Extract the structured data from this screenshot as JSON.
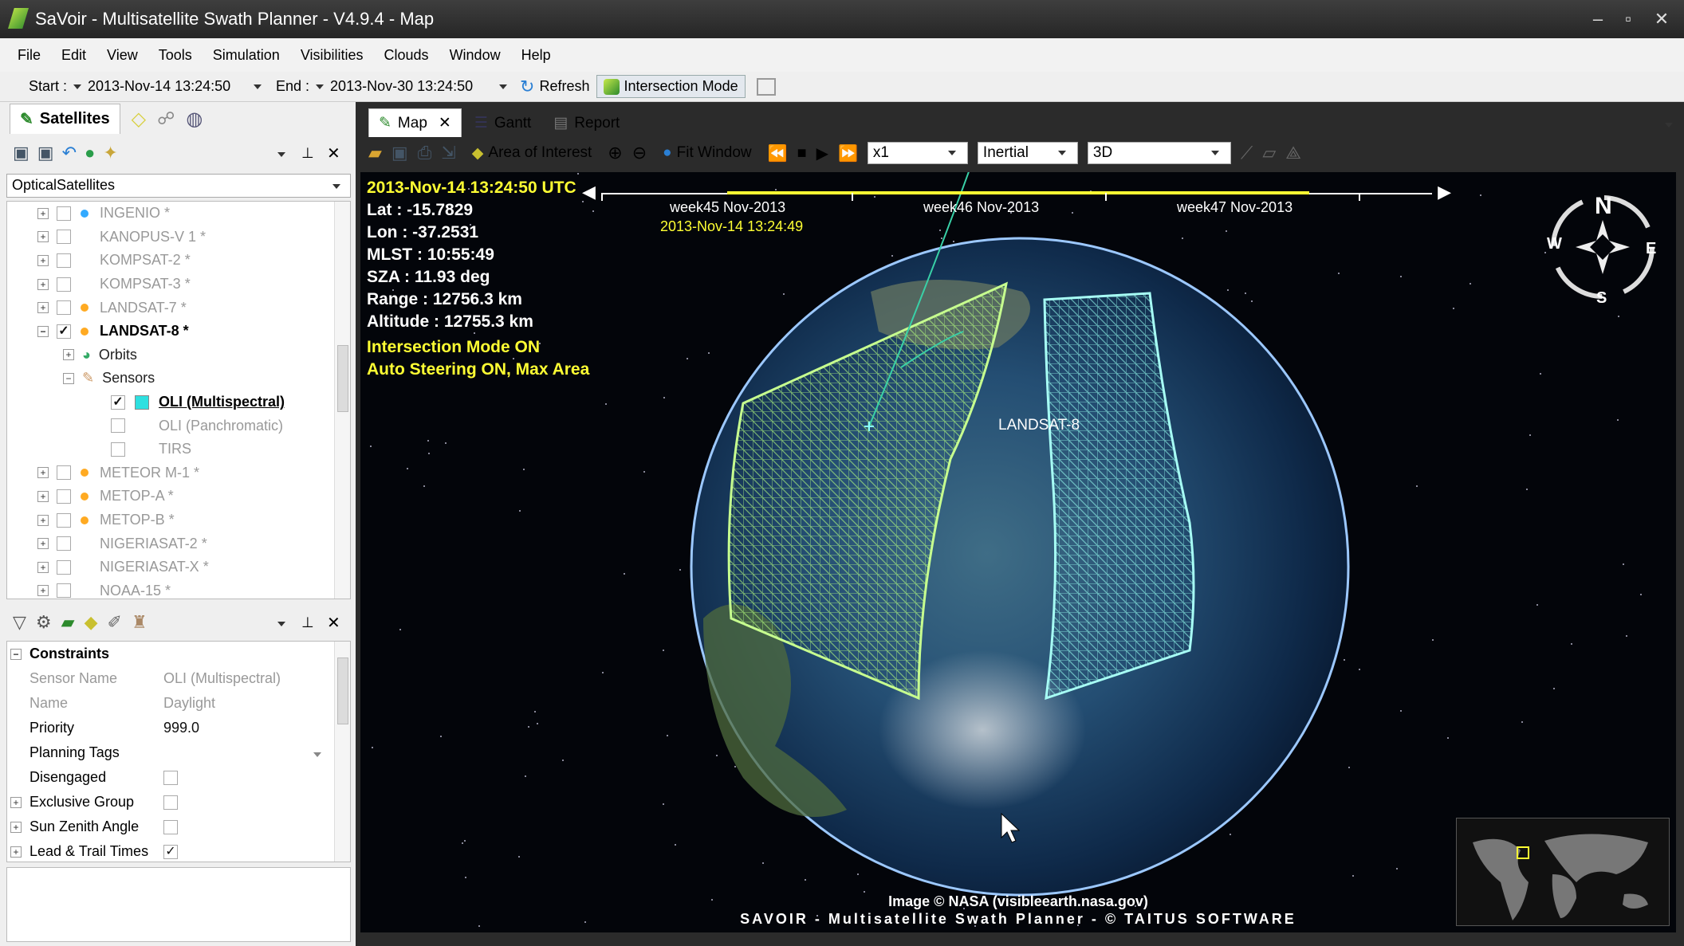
{
  "window": {
    "title": "SaVoir - Multisatellite Swath Planner - V4.9.4 - Map"
  },
  "menu": [
    "File",
    "Edit",
    "View",
    "Tools",
    "Simulation",
    "Visibilities",
    "Clouds",
    "Window",
    "Help"
  ],
  "toolbar": {
    "start_label": "Start :",
    "start_value": "2013-Nov-14 13:24:50",
    "end_label": "End :",
    "end_value": "2013-Nov-30 13:24:50",
    "refresh_label": "Refresh",
    "intersection_label": "Intersection Mode"
  },
  "left": {
    "satellites_tab": "Satellites",
    "group": "OpticalSatellites",
    "tree": [
      {
        "label": "INGENIO *",
        "dot": "#33aaff"
      },
      {
        "label": "KANOPUS-V 1 *"
      },
      {
        "label": "KOMPSAT-2 *"
      },
      {
        "label": "KOMPSAT-3 *"
      },
      {
        "label": "LANDSAT-7 *",
        "dot": "#ffaa22"
      },
      {
        "label": "LANDSAT-8 *",
        "dot": "#ffaa22"
      },
      {
        "label": "Orbits"
      },
      {
        "label": "Sensors"
      },
      {
        "label": "OLI (Multispectral)"
      },
      {
        "label": "OLI (Panchromatic)"
      },
      {
        "label": "TIRS"
      },
      {
        "label": "METEOR M-1 *",
        "dot": "#ffaa22"
      },
      {
        "label": "METOP-A *",
        "dot": "#ffaa22"
      },
      {
        "label": "METOP-B *",
        "dot": "#ffaa22"
      },
      {
        "label": "NIGERIASAT-2 *"
      },
      {
        "label": "NIGERIASAT-X *"
      },
      {
        "label": "NOAA-15 *"
      }
    ],
    "props": {
      "section": "Constraints",
      "rows": [
        {
          "k": "Sensor Name",
          "v": "OLI (Multispectral)"
        },
        {
          "k": "Name",
          "v": "Daylight"
        },
        {
          "k": "Priority",
          "v": "999.0"
        },
        {
          "k": "Planning Tags",
          "v": ""
        },
        {
          "k": "Disengaged",
          "v": ""
        },
        {
          "k": "Exclusive Group",
          "v": ""
        },
        {
          "k": "Sun Zenith Angle",
          "v": ""
        },
        {
          "k": "Lead & Trail Times",
          "v": "✓"
        }
      ]
    }
  },
  "tabs": {
    "map": "Map",
    "gantt": "Gantt",
    "report": "Report"
  },
  "maptools": {
    "aoi": "Area of Interest",
    "fit": "Fit Window",
    "speed": "x1",
    "frame": "Inertial",
    "view": "3D"
  },
  "map": {
    "utc": "2013-Nov-14 13:24:50 UTC",
    "lat": "Lat : -15.7829",
    "lon": "Lon : -37.2531",
    "mlst": "MLST : 10:55:49",
    "sza": "SZA : 11.93 deg",
    "range": "Range : 12756.3 km",
    "alt": "Altitude : 12755.3 km",
    "mode1": "Intersection Mode ON",
    "mode2": "Auto Steering ON, Max Area",
    "weeks": [
      "week45 Nov-2013",
      "week46 Nov-2013",
      "week47 Nov-2013"
    ],
    "cursor_time": "2013-Nov-14 13:24:49",
    "sat_label": "LANDSAT-8",
    "compass": {
      "n": "N",
      "s": "S",
      "e": "E",
      "w": "W"
    },
    "credit1": "Image © NASA (visibleearth.nasa.gov)",
    "credit2": "SAVOIR - Multisatellite Swath Planner - © TAITUS SOFTWARE"
  },
  "colors": {
    "swath_left": "#a8f27a",
    "swath_right": "#7ff0e8",
    "highlight": "#ffff33"
  }
}
